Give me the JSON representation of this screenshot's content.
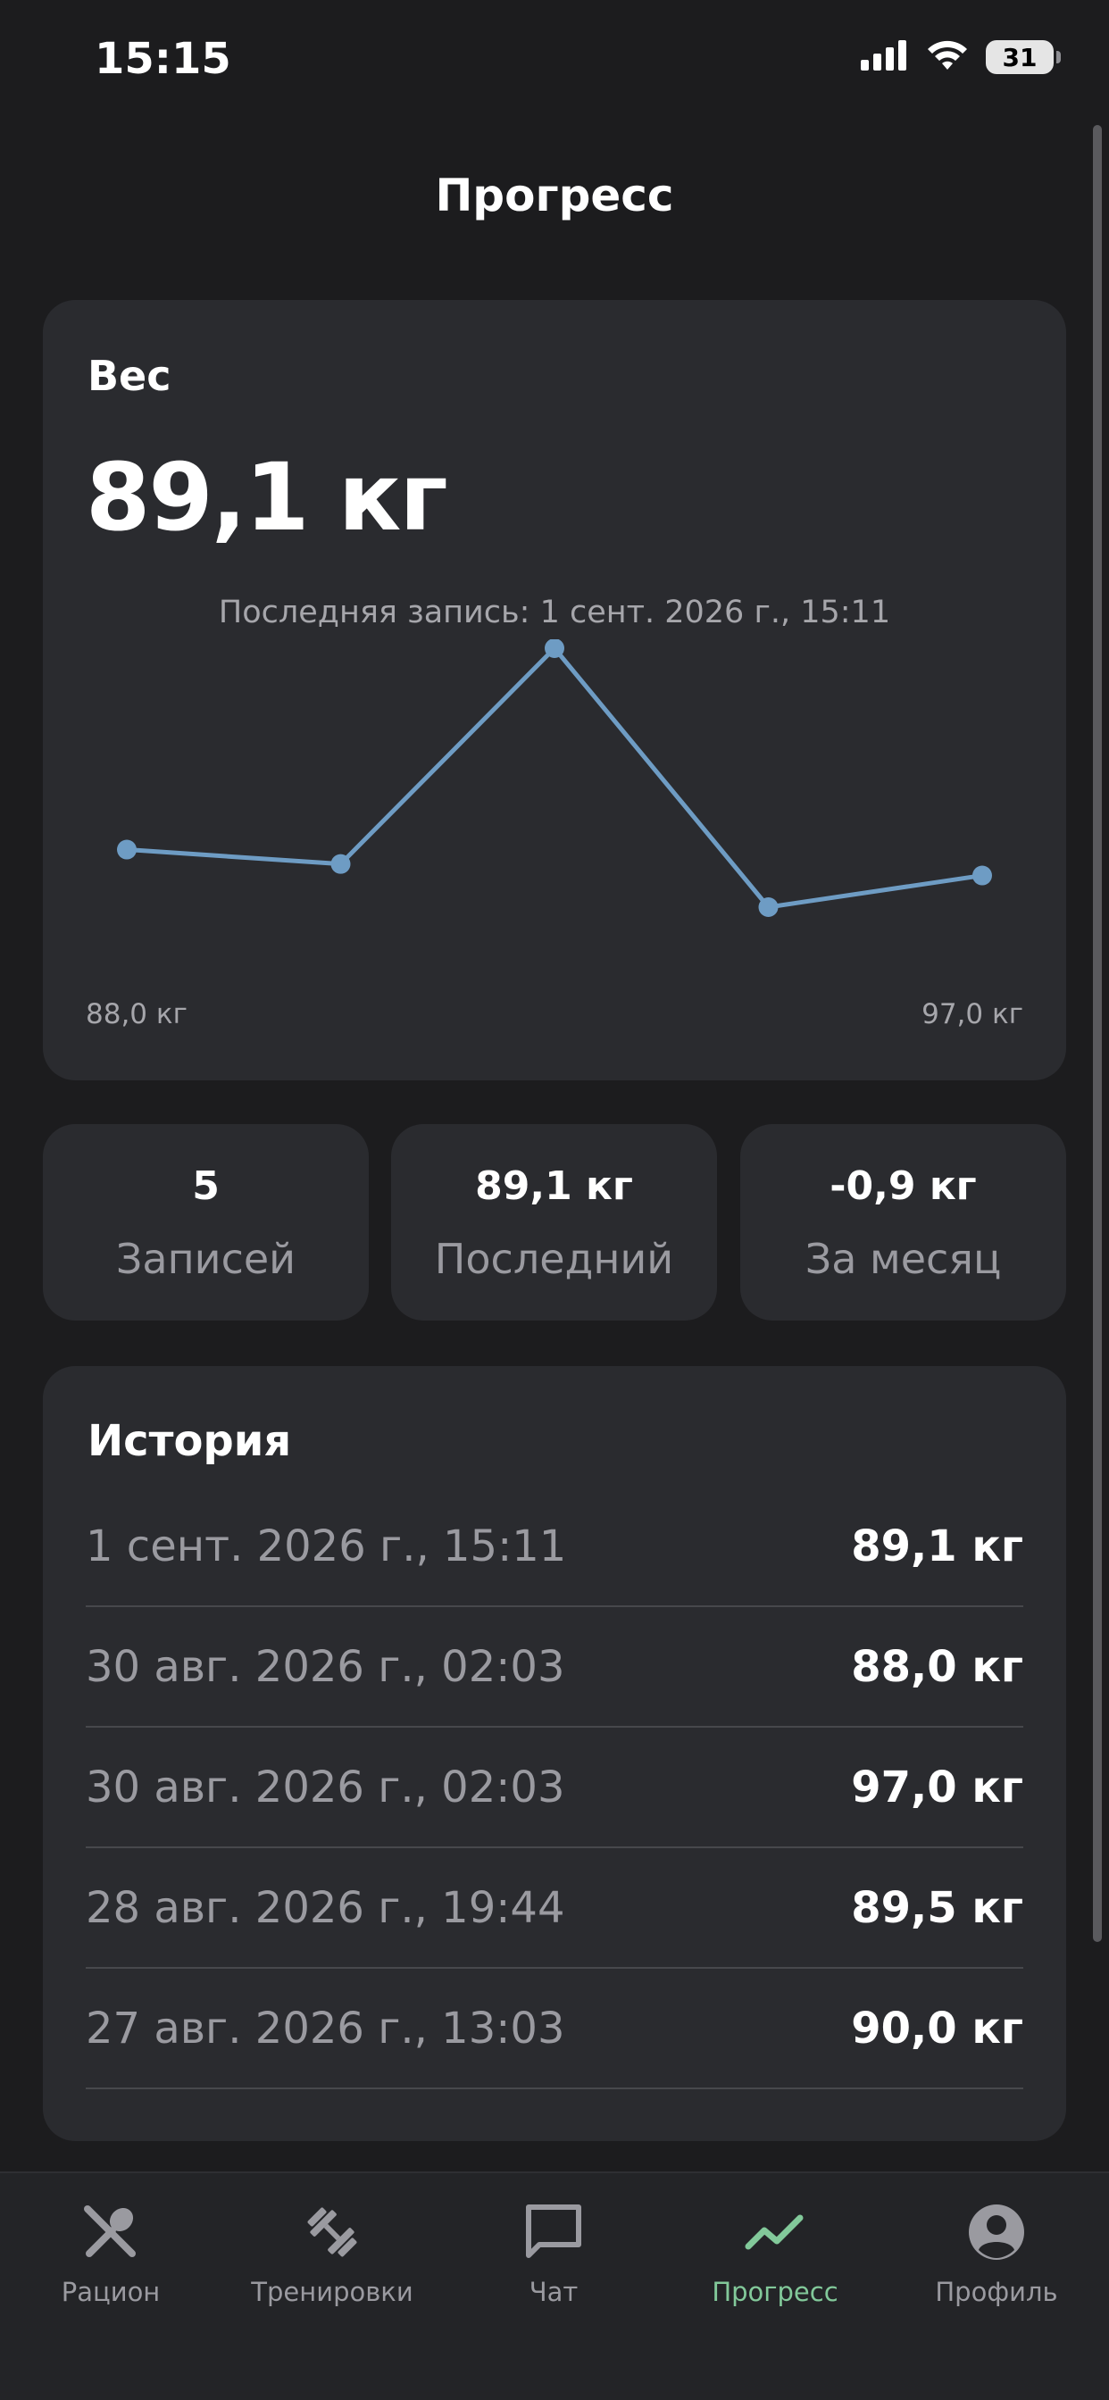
{
  "status_bar": {
    "time": "15:15",
    "battery": "31"
  },
  "header": {
    "title": "Прогресс"
  },
  "weight_card": {
    "label": "Вес",
    "value": "89,1 кг",
    "last_entry": "Последняя запись: 1 сент. 2026 г., 15:11",
    "axis_min": "88,0 кг",
    "axis_max": "97,0 кг",
    "line_color": "#6e9cc4"
  },
  "chart_data": {
    "type": "line",
    "x": [
      "27 авг. 2026 г., 13:03",
      "28 авг. 2026 г., 19:44",
      "30 авг. 2026 г., 02:03",
      "30 авг. 2026 г., 02:03",
      "1 сент. 2026 г., 15:11"
    ],
    "values": [
      90.0,
      89.5,
      97.0,
      88.0,
      89.1
    ],
    "ylim": [
      88.0,
      97.0
    ],
    "grid": false
  },
  "stats": [
    {
      "value": "5",
      "label": "Записей"
    },
    {
      "value": "89,1 кг",
      "label": "Последний"
    },
    {
      "value": "-0,9 кг",
      "label": "За месяц"
    }
  ],
  "history": {
    "title": "История",
    "rows": [
      {
        "date": "1 сент. 2026 г., 15:11",
        "weight": "89,1 кг"
      },
      {
        "date": "30 авг. 2026 г., 02:03",
        "weight": "88,0 кг"
      },
      {
        "date": "30 авг. 2026 г., 02:03",
        "weight": "97,0 кг"
      },
      {
        "date": "28 авг. 2026 г., 19:44",
        "weight": "89,5 кг"
      },
      {
        "date": "27 авг. 2026 г., 13:03",
        "weight": "90,0 кг"
      }
    ]
  },
  "tabs": [
    {
      "label": "Рацион",
      "icon": "fork-knife-icon"
    },
    {
      "label": "Тренировки",
      "icon": "dumbbell-icon"
    },
    {
      "label": "Чат",
      "icon": "chat-bubble-icon"
    },
    {
      "label": "Прогресс",
      "icon": "trend-icon",
      "active": true
    },
    {
      "label": "Профиль",
      "icon": "profile-icon"
    }
  ],
  "colors": {
    "accent": "#82c99a",
    "card": "#2a2b2f",
    "background": "#1c1c1e"
  }
}
